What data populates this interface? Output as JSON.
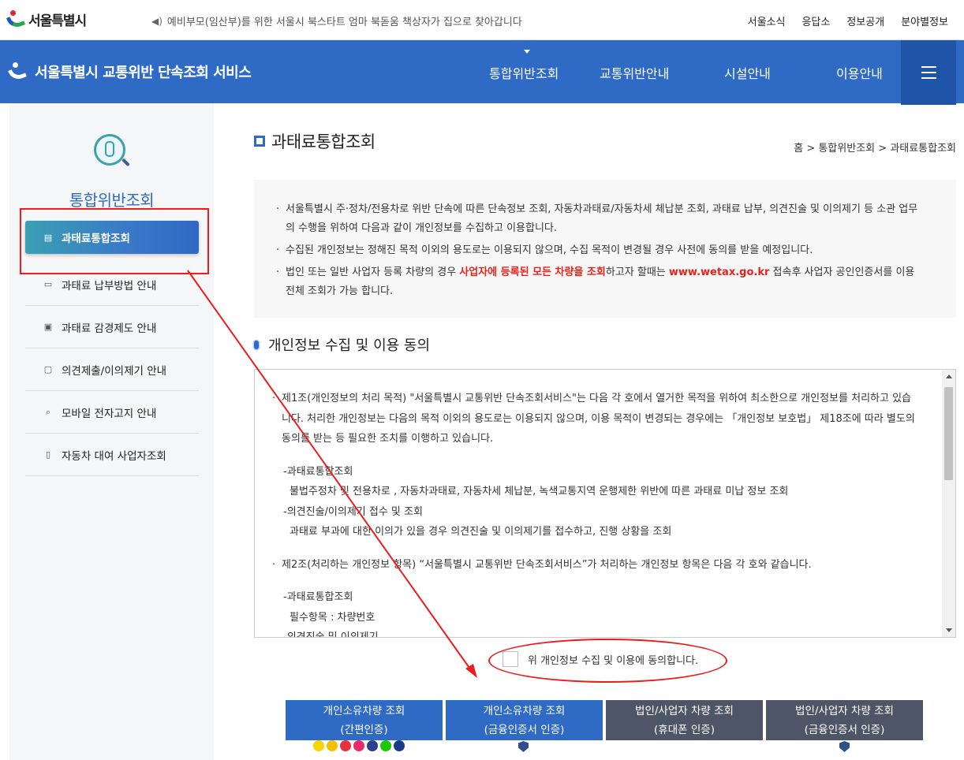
{
  "topbar": {
    "logo_text": "서울특별시",
    "notice": "예비부모(임산부)를 위한 서울시 북스타트 엄마 북돋움 책상자가 집으로 찾아갑니다",
    "links": [
      "서울소식",
      "응답소",
      "정보공개",
      "분야별정보"
    ]
  },
  "nav": {
    "site_title": "서울특별시 교통위반 단속조회 서비스",
    "items": [
      "통합위반조회",
      "교통위반안내",
      "시설안내",
      "이용안내"
    ]
  },
  "sidebar": {
    "title": "통합위반조회",
    "items": [
      {
        "label": "과태료통합조회",
        "icon": "coins-icon",
        "active": true
      },
      {
        "label": "과태료 납부방법 안내",
        "icon": "card-icon"
      },
      {
        "label": "과태료 감경제도 안내",
        "icon": "clipboard-icon"
      },
      {
        "label": "의견제출/이의제기 안내",
        "icon": "document-icon"
      },
      {
        "label": "모바일 전자고지 안내",
        "icon": "search-icon"
      },
      {
        "label": "자동차 대여 사업자조회",
        "icon": "mobile-icon"
      }
    ]
  },
  "main": {
    "page_title": "과태료통합조회",
    "breadcrumb": "홈 > 통합위반조회 > 과태료통합조회",
    "info": {
      "p1": "서울특별시 주·정차/전용차로 위반 단속에 따른 단속정보 조회, 자동차과태료/자동차세 체납분 조회, 과태료 납부, 의견진술 및 이의제기 등 소관 업무의 수행을 위하여 다음과 같이 개인정보를 수집하고 이용합니다.",
      "p2": "수집된 개인정보는 정해진 목적 이외의 용도로는 이용되지 않으며, 수집 목적이 변경될 경우 사전에 동의를 받을 예정입니다.",
      "p3_a": "법인 또는 일반 사업자 등록 차량의 경우 ",
      "p3_red": "사업자에 등록된 모든 차량을 조회",
      "p3_b": "하고자 할때는 ",
      "p3_link": "www.wetax.go.kr",
      "p3_c": " 접속후 사업자 공인인증서를 이용 전체 조회가 가능 합니다."
    },
    "section_title": "개인정보 수집 및 이용 동의",
    "terms": {
      "a1": "제1조(개인정보의 처리 목적) \"서울특별시 교통위반 단속조회서비스\"는 다음 각 호에서 열거한 목적을 위하여 최소한으로 개인정보를 처리하고 있습니다. 처리한 개인정보는 다음의 목적 이외의 용도로는 이용되지 않으며, 이용 목적이 변경되는 경우에는 「개인정보 보호법」 제18조에 따라 별도의 동의를 받는 등 필요한 조치를 이행하고 있습니다.",
      "s1": "-과태료통합조회",
      "s1d": "불법주정차 및 전용차로 , 자동차과태료, 자동차세 체납분, 녹색교통지역 운행제한 위반에 따른 과태료 미납 정보 조회",
      "s2": "-의견진술/이의제기 접수 및 조회",
      "s2d": "과태료 부과에 대한 이의가 있을 경우 의견진술 및 이의제기를 접수하고, 진행 상황을 조회",
      "a2": "제2조(처리하는 개인정보 항목) “서울특별시 교통위반 단속조회서비스”가 처리하는 개인정보 항목은 다음 각 호와 같습니다.",
      "s3": "-과태료통합조회",
      "s3d": "필수항목 : 차량번호",
      "s4": "-의견진술 및 이의제기"
    },
    "agree_label": "위 개인정보 수집 및 이용에 동의합니다.",
    "buttons": [
      {
        "line1": "개인소유차량 조회",
        "line2": "(간편인증)"
      },
      {
        "line1": "개인소유차량 조회",
        "line2": "(금융인증서 인증)"
      },
      {
        "line1": "법인/사업자 차량 조회",
        "line2": "(휴대폰 인증)"
      },
      {
        "line1": "법인/사업자 차량 조회",
        "line2": "(금융인증서 인증)"
      }
    ]
  },
  "colors": {
    "nav_blue": "#2f6ac4",
    "btn_gray": "#4e5566",
    "annotation_red": "#ee1c1c"
  }
}
